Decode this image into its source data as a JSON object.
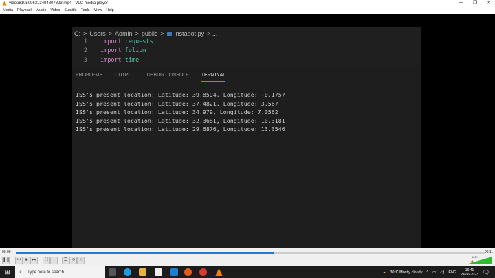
{
  "window": {
    "title": "video8105096313484807823.mp4 - VLC media player",
    "controls": [
      "—",
      "❐",
      "✕"
    ]
  },
  "menu": [
    "Media",
    "Playback",
    "Audio",
    "Video",
    "Subtitle",
    "Tools",
    "View",
    "Help"
  ],
  "editor": {
    "breadcrumb": [
      "C:",
      ">",
      "Users",
      ">",
      "Admin",
      ">",
      "public",
      ">"
    ],
    "file": "instabot.py",
    "crumb_tail": "> ...",
    "lines": [
      {
        "n": "1",
        "kw": "import",
        "mod": "requests"
      },
      {
        "n": "2",
        "kw": "import",
        "mod": "folium"
      },
      {
        "n": "3",
        "kw": "import",
        "mod": "time"
      }
    ]
  },
  "panel": {
    "tabs": [
      "PROBLEMS",
      "OUTPUT",
      "DEBUG CONSOLE",
      "TERMINAL"
    ],
    "active": "TERMINAL",
    "terminal": [
      "ISS's present location: Latitude: 39.8594, Longitude: -0.1757",
      "ISS's present location: Latitude: 37.4821, Longitude: 3.567",
      "ISS's present location: Latitude: 34.979, Longitude: 7.0562",
      "ISS's present location: Latitude: 32.3681, Longitude: 10.3181",
      "ISS's present location: Latitude: 29.6876, Longitude: 13.3546"
    ]
  },
  "player": {
    "elapsed": "00:06",
    "total": "00:11",
    "progress_percent": 55,
    "volume": "100%",
    "volume_percent": 100
  },
  "taskbar": {
    "search_placeholder": "Type here to search",
    "weather": "30°C  Mostly cloudy",
    "lang": "ENG",
    "time": "16:41",
    "date": "24-06-2023"
  }
}
